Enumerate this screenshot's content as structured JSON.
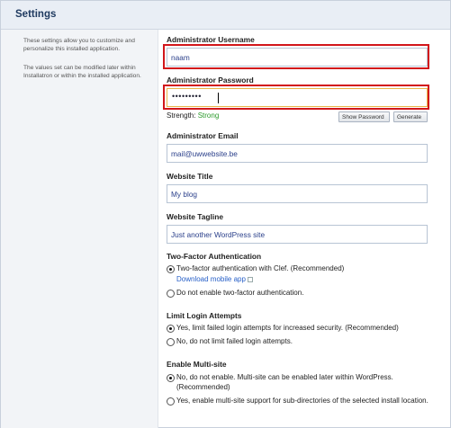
{
  "panel": {
    "title": "Settings"
  },
  "sidebar": {
    "description1": "These settings allow you to customize and personalize this installed application.",
    "description2": "The values set can be modified later within Installatron or within the installed application."
  },
  "fields": {
    "admin_username": {
      "label": "Administrator Username",
      "value": "naam"
    },
    "admin_password": {
      "label": "Administrator Password",
      "masked_value": "•••••••••"
    },
    "admin_email": {
      "label": "Administrator Email",
      "value": "mail@uwwebsite.be"
    },
    "website_title": {
      "label": "Website Title",
      "value": "My blog"
    },
    "website_tagline": {
      "label": "Website Tagline",
      "value": "Just another WordPress site"
    }
  },
  "password_tools": {
    "strength_label": "Strength:",
    "strength_value": "Strong",
    "strength_color": "#2b9a2b",
    "show_password_label": "Show Password",
    "generate_label": "Generate"
  },
  "two_factor": {
    "label": "Two-Factor Authentication",
    "option1": "Two-factor authentication with Clef. (Recommended)",
    "download_link": "Download mobile app",
    "option2": "Do not enable two-factor authentication.",
    "selected": 1
  },
  "limit_login": {
    "label": "Limit Login Attempts",
    "option1": "Yes, limit failed login attempts for increased security. (Recommended)",
    "option2": "No, do not limit failed login attempts.",
    "selected": 1
  },
  "multisite": {
    "label": "Enable Multi-site",
    "option1": "No, do not enable. Multi-site can be enabled later within WordPress. (Recommended)",
    "option2": "Yes, enable multi-site support for sub-directories of the selected install location.",
    "selected": 1
  },
  "colors": {
    "highlight": "#d2161a",
    "header_bg": "#e9eef5",
    "title_text": "#1f3a60",
    "link": "#2860c8"
  }
}
